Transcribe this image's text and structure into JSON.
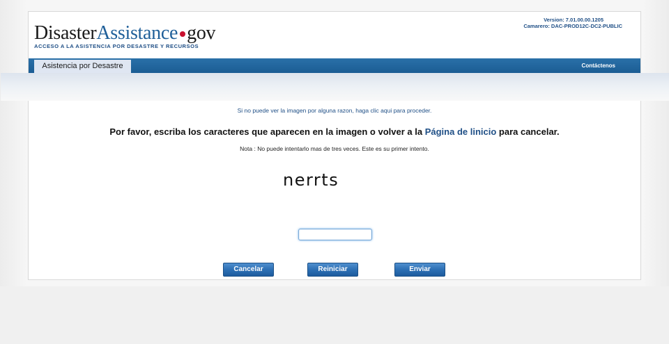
{
  "header": {
    "logo_disaster": "Disaster",
    "logo_assistance": "Assistance",
    "logo_gov": "gov",
    "tagline": "ACCESO A LA ASISTENCIA POR DESASTRE Y RECURSOS",
    "version": "Version: 7.01.00.00.1205",
    "server": "Camarero: DAC-PROD12C-DC2-PUBLIC"
  },
  "nav": {
    "tab_label": "Asistencia por Desastre",
    "contact_label": "Contáctenos"
  },
  "content": {
    "info_link": "Si no puede ver la imagen por alguna razon, haga clic aqui para proceder.",
    "instruction_before": "Por favor, escriba los caracteres que aparecen en la imagen o volver a la ",
    "instruction_link": "Página de linicio",
    "instruction_after": " para cancelar.",
    "note": "Nota : No puede intentarlo mas de tres veces. Este es su primer intento.",
    "captcha_text": "nerrts",
    "input_value": ""
  },
  "buttons": {
    "cancel": "Cancelar",
    "reset": "Reiniciar",
    "submit": "Enviar"
  },
  "colors": {
    "brand_blue": "#1f5f99",
    "link_blue": "#1f4f86",
    "nav_bar": "#1b5d94",
    "logo_dot": "#c8102e"
  }
}
